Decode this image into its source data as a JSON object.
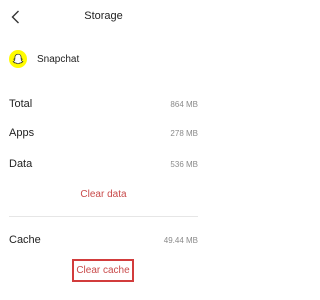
{
  "header": {
    "title": "Storage",
    "back_icon": "back-arrow-icon"
  },
  "app": {
    "name": "Snapchat",
    "icon": "snapchat-ghost-icon",
    "icon_color": "#FFFC00"
  },
  "stats": [
    {
      "label": "Total",
      "value": "864 MB"
    },
    {
      "label": "Apps",
      "value": "278 MB"
    },
    {
      "label": "Data",
      "value": "536 MB"
    }
  ],
  "clear_data_label": "Clear data",
  "cache": {
    "label": "Cache",
    "value": "49.44 MB"
  },
  "clear_cache_label": "Clear cache",
  "colors": {
    "action_text": "#c94a4a",
    "highlight_border": "#d23c3c"
  }
}
